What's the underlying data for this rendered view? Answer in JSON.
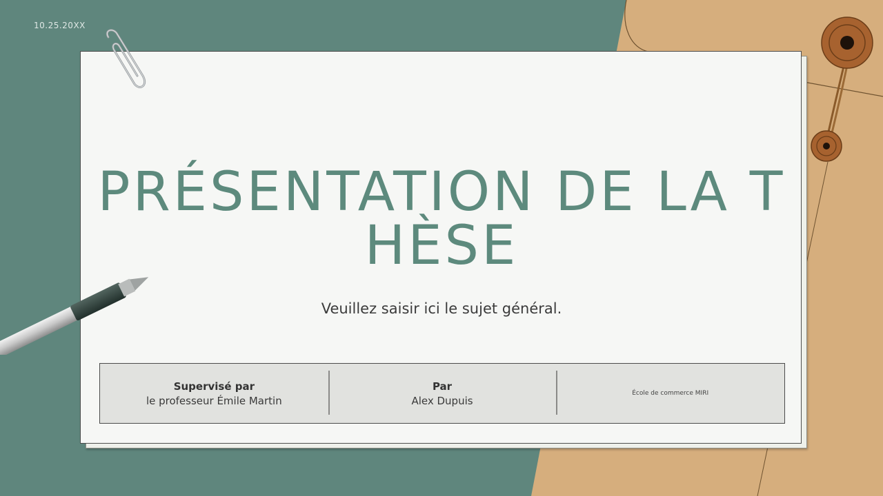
{
  "slide": {
    "date": "10.25.20XX",
    "title_line1": "PRÉSENTATION DE LA T",
    "title_line2": "HÈSE",
    "subtitle": "Veuillez saisir ici le sujet général."
  },
  "info": {
    "supervisor_heading": "Supervisé par",
    "supervisor_name": "le professeur Émile Martin",
    "author_heading": "Par",
    "author_name": "Alex Dupuis",
    "school": "École de commerce MIRI"
  },
  "colors": {
    "background_green": "#5f867d",
    "envelope_tan": "#d6ae7d",
    "title_green": "#5d8a7d",
    "paper": "#f6f7f5"
  },
  "icons": [
    "paperclip-icon",
    "pen-icon",
    "envelope-button-icon"
  ]
}
